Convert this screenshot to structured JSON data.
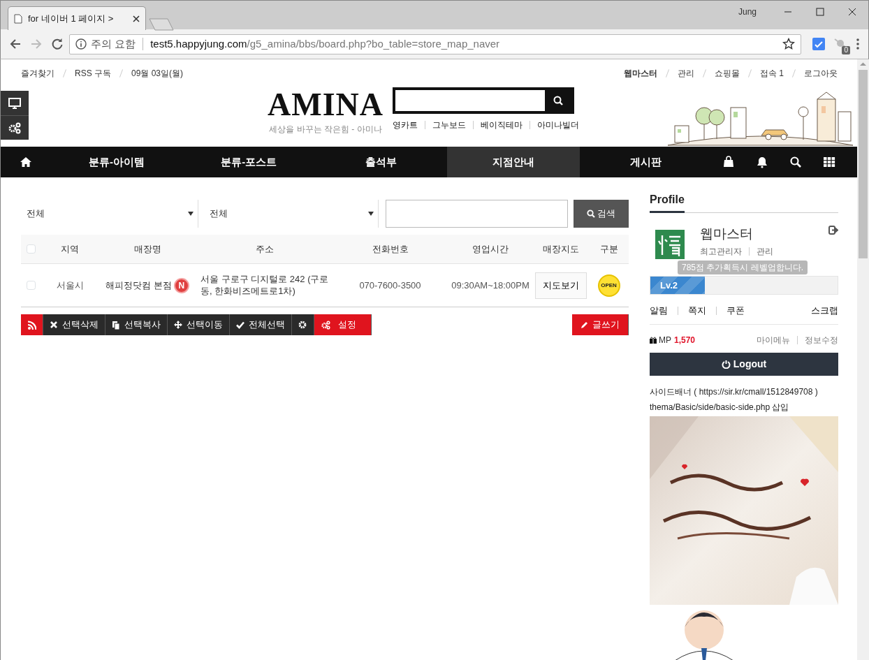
{
  "browser": {
    "tab_title": "for 네이버 1 페이지 >",
    "security_label": "주의 요함",
    "url_host": "test5.happyjung.com",
    "url_path": "/g5_amina/bbs/board.php?bo_table=store_map_naver",
    "profile_name": "Jung",
    "extension_badge": "0"
  },
  "topbar": {
    "left": [
      "즐겨찾기",
      "RSS 구독",
      "09월 03일(월)"
    ],
    "right": [
      {
        "label": "웹마스터",
        "bold": true
      },
      {
        "label": "관리",
        "bold": false
      },
      {
        "label": "쇼핑몰",
        "bold": false
      },
      {
        "label": "접속 1",
        "bold": false
      },
      {
        "label": "로그아웃",
        "bold": false
      }
    ]
  },
  "header": {
    "logo": "AMINA",
    "tagline": "세상을 바꾸는 작은힘 - 아미나",
    "links": [
      "영카트",
      "그누보드",
      "베이직테마",
      "아미나빌더"
    ]
  },
  "nav": [
    {
      "label": "분류-아이템",
      "selected": false
    },
    {
      "label": "분류-포스트",
      "selected": false
    },
    {
      "label": "출석부",
      "selected": false
    },
    {
      "label": "지점안내",
      "selected": true
    },
    {
      "label": "게시판",
      "selected": false
    }
  ],
  "filters": {
    "category": "전체",
    "subcategory": "전체",
    "search_button": "검색"
  },
  "table": {
    "all_checked": false,
    "columns": [
      "지역",
      "매장명",
      "주소",
      "전화번호",
      "영업시간",
      "매장지도",
      "구분"
    ],
    "rows": [
      {
        "checked": false,
        "region": "서울시",
        "name": "해피정닷컴 본점",
        "is_new": true,
        "new_badge": "N",
        "address": "서울 구로구 디지털로 242 (구로동, 한화비즈메트로1차)",
        "phone": "070-7600-3500",
        "hours": "09:30AM~18:00PM",
        "map_button": "지도보기",
        "status": "OPEN"
      }
    ]
  },
  "toolbar": [
    {
      "kind": "rss"
    },
    {
      "kind": "delete",
      "label": "선택삭제"
    },
    {
      "kind": "copy",
      "label": "선택복사"
    },
    {
      "kind": "move",
      "label": "선택이동"
    },
    {
      "kind": "select-all",
      "label": "전체선택"
    },
    {
      "kind": "gear"
    },
    {
      "kind": "settings",
      "label": "설정"
    }
  ],
  "write_button": "글쓰기",
  "sidebar": {
    "title": "Profile",
    "name": "웹마스터",
    "role": "최고관리자",
    "admin_link": "관리",
    "tooltip": "785점 추가획득시 레벨업합니다.",
    "level_label": "Lv.2",
    "level": 0.29,
    "links": [
      "알림",
      "쪽지",
      "쿠폰",
      "스크랩"
    ],
    "mp_label": "MP",
    "mp_value": "1,570",
    "my_menu": "마이메뉴",
    "edit_info": "정보수정",
    "logout": "Logout",
    "banner_text": [
      "사이드배너 ( https://sir.kr/cmall/1512849708 )",
      "thema/Basic/side/basic-side.php 삽입"
    ]
  }
}
